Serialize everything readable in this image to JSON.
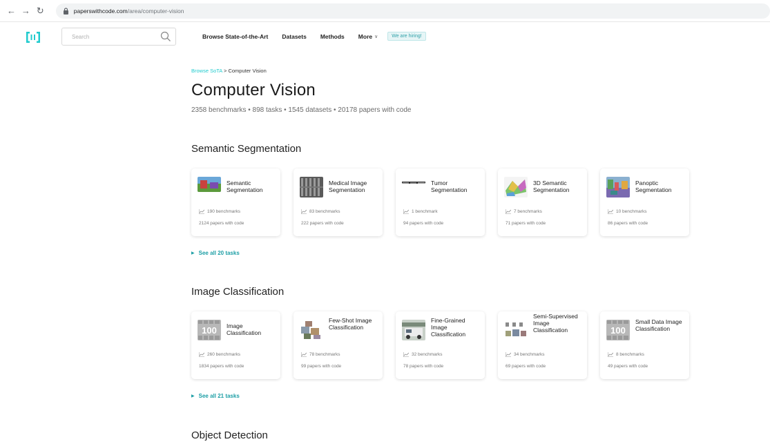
{
  "browser": {
    "url_host": "paperswithcode.com",
    "url_path": "/area/computer-vision"
  },
  "nav": {
    "search_placeholder": "Search",
    "links": [
      "Browse State-of-the-Art",
      "Datasets",
      "Methods"
    ],
    "more_label": "More",
    "hiring_label": "We are hiring!"
  },
  "page": {
    "breadcrumb_link": "Browse SoTA",
    "breadcrumb_sep": " > ",
    "breadcrumb_current": "Computer Vision",
    "title": "Computer Vision",
    "stats": "2358 benchmarks • 898 tasks • 1545 datasets • 20178 papers with code"
  },
  "sections": [
    {
      "title": "Semantic Segmentation",
      "see_all": "See all 20 tasks",
      "cards": [
        {
          "name": "Semantic Segmentation",
          "benchmarks": "190 benchmarks",
          "papers": "2124 papers with code"
        },
        {
          "name": "Medical Image Segmentation",
          "benchmarks": "83 benchmarks",
          "papers": "222 papers with code"
        },
        {
          "name": "Tumor Segmentation",
          "benchmarks": "1 benchmark",
          "papers": "94 papers with code"
        },
        {
          "name": "3D Semantic Segmentation",
          "benchmarks": "7 benchmarks",
          "papers": "71 papers with code"
        },
        {
          "name": "Panoptic Segmentation",
          "benchmarks": "10 benchmarks",
          "papers": "86 papers with code"
        }
      ]
    },
    {
      "title": "Image Classification",
      "see_all": "See all 21 tasks",
      "cards": [
        {
          "name": "Image Classification",
          "benchmarks": "260 benchmarks",
          "papers": "1834 papers with code"
        },
        {
          "name": "Few-Shot Image Classification",
          "benchmarks": "78 benchmarks",
          "papers": "99 papers with code"
        },
        {
          "name": "Fine-Grained Image Classification",
          "benchmarks": "32 benchmarks",
          "papers": "78 papers with code"
        },
        {
          "name": "Semi-Supervised Image Classification",
          "benchmarks": "34 benchmarks",
          "papers": "69 papers with code"
        },
        {
          "name": "Small Data Image Classification",
          "benchmarks": "8 benchmarks",
          "papers": "49 papers with code"
        }
      ]
    },
    {
      "title": "Object Detection"
    }
  ],
  "colors": {
    "accent": "#21cbce",
    "link_teal": "#1c9ea5"
  }
}
